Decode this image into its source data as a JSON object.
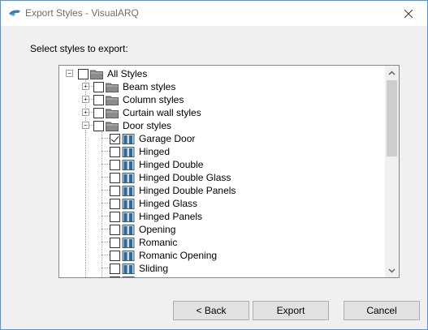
{
  "window": {
    "title": "Export Styles - VisualARQ",
    "app_icon": "visualarq-logo-icon",
    "close_icon": "close-icon"
  },
  "prompt": "Select styles to export:",
  "tree": {
    "root": {
      "label": "All Styles",
      "expanded": true,
      "checked": false
    },
    "groups": [
      {
        "label": "Beam styles",
        "expanded": false,
        "checked": false
      },
      {
        "label": "Column styles",
        "expanded": false,
        "checked": false
      },
      {
        "label": "Curtain wall styles",
        "expanded": false,
        "checked": false
      },
      {
        "label": "Door styles",
        "expanded": true,
        "checked": false
      }
    ],
    "door_items": [
      {
        "label": "Garage Door",
        "checked": true
      },
      {
        "label": "Hinged",
        "checked": false
      },
      {
        "label": "Hinged Double",
        "checked": false
      },
      {
        "label": "Hinged Double Glass",
        "checked": false
      },
      {
        "label": "Hinged Double Panels",
        "checked": false
      },
      {
        "label": "Hinged Glass",
        "checked": false
      },
      {
        "label": "Hinged Panels",
        "checked": false
      },
      {
        "label": "Opening",
        "checked": false
      },
      {
        "label": "Romanic",
        "checked": false
      },
      {
        "label": "Romanic Opening",
        "checked": false
      },
      {
        "label": "Sliding",
        "checked": false
      }
    ]
  },
  "buttons": {
    "back": "< Back",
    "export": "Export",
    "cancel": "Cancel"
  },
  "colors": {
    "title_text": "#6d6d6d",
    "window_border": "#5e8fc7",
    "dialog_bg": "#f0f0f0",
    "button_bg": "#e1e1e1",
    "scroll_thumb": "#cdcdcd",
    "folder_gray": "#8c8c8c",
    "door_blue": "#1d6fa5"
  }
}
